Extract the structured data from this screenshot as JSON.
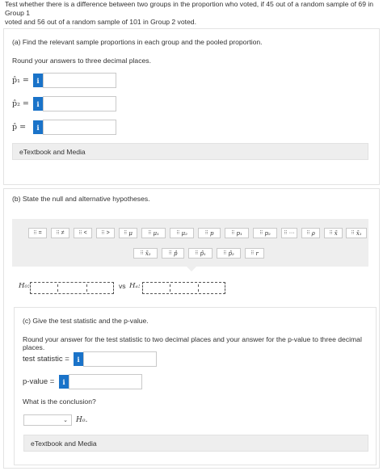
{
  "intro_line1": "Test whether there is a difference between two groups in the proportion who voted, if 45 out of a random sample of 69 in Group 1",
  "intro_line2": "voted and 56 out of a random sample of 101 in Group 2 voted.",
  "part_a": {
    "title": "(a) Find the relevant sample proportions in each group and the pooled proportion.",
    "instruction": "Round your answers to three decimal places.",
    "p1_label": "p̂₁ =",
    "p2_label": "p̂₂ =",
    "p_label": "p̂ =",
    "info_glyph": "i",
    "p1_value": "",
    "p2_value": "",
    "p_value": "",
    "etext": "eTextbook and Media"
  },
  "part_b": {
    "title": "(b) State the null and alternative hypotheses.",
    "palette_row1": [
      "=",
      "≠",
      "<",
      ">",
      "μ",
      "μ₁",
      "μ₂",
      "p",
      "p₁",
      "p₂",
      "···",
      "ρ",
      "x̄",
      "x̄₁"
    ],
    "palette_row2": [
      "x̄₂",
      "p̂",
      "p̂₁",
      "p̂₂",
      "r"
    ],
    "drag_handle": "⠿",
    "h0_label": "H₀:",
    "vs_label": "vs",
    "ha_label": "Hₐ:"
  },
  "part_c": {
    "title": "(c) Give the test statistic and the p-value.",
    "instruction": "Round your answer for the test statistic to two decimal places and your answer for the p-value to three decimal places.",
    "ts_label": "test statistic  =",
    "pv_label": "p-value  =",
    "ts_value": "",
    "pv_value": "",
    "conclusion_q": "What is the conclusion?",
    "conclusion_selected": "",
    "conclusion_suffix": "H₀.",
    "etext": "eTextbook and Media"
  },
  "colors": {
    "info": "#1a73c9",
    "palette_bg": "#eeeeee",
    "etext_bg": "#eeeeee"
  },
  "icons": {
    "info": "info-icon",
    "drag": "drag-handle-icon",
    "chevron": "chevron-down-icon"
  }
}
